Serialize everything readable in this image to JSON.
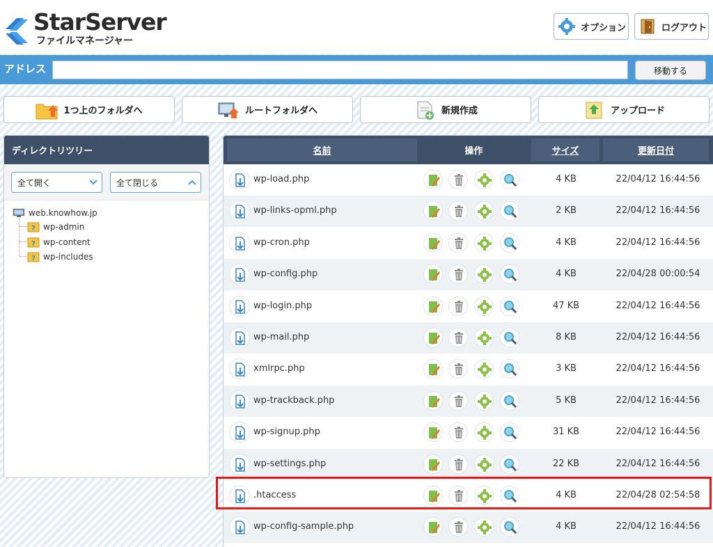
{
  "brand": {
    "title": "StarServer",
    "subtitle": "ファイルマネージャー",
    "accent": "#4a9ad8"
  },
  "header": {
    "option_label": "オプション",
    "logout_label": "ログアウト"
  },
  "address": {
    "label": "アドレス",
    "value": "",
    "go_label": "移動する"
  },
  "toolbar": {
    "up_label": "1つ上のフォルダへ",
    "root_label": "ルートフォルダへ",
    "new_label": "新規作成",
    "upload_label": "アップロード"
  },
  "tree": {
    "title": "ディレクトリツリー",
    "expand_label": "全て開く",
    "collapse_label": "全て閉じる",
    "root": "web.knowhow.jp",
    "children": [
      "wp-admin",
      "wp-content",
      "wp-includes"
    ]
  },
  "table": {
    "columns": {
      "name": "名前",
      "ops": "操作",
      "size": "サイズ",
      "date": "更新日付"
    },
    "rows": [
      {
        "name": "wp-load.php",
        "size": "4 KB",
        "date": "22/04/12 16:44:56"
      },
      {
        "name": "wp-links-opml.php",
        "size": "2 KB",
        "date": "22/04/12 16:44:56"
      },
      {
        "name": "wp-cron.php",
        "size": "4 KB",
        "date": "22/04/12 16:44:56"
      },
      {
        "name": "wp-config.php",
        "size": "4 KB",
        "date": "22/04/28 00:00:54"
      },
      {
        "name": "wp-login.php",
        "size": "47 KB",
        "date": "22/04/12 16:44:56"
      },
      {
        "name": "wp-mail.php",
        "size": "8 KB",
        "date": "22/04/12 16:44:56"
      },
      {
        "name": "xmlrpc.php",
        "size": "3 KB",
        "date": "22/04/12 16:44:56"
      },
      {
        "name": "wp-trackback.php",
        "size": "5 KB",
        "date": "22/04/12 16:44:56"
      },
      {
        "name": "wp-signup.php",
        "size": "31 KB",
        "date": "22/04/12 16:44:56"
      },
      {
        "name": "wp-settings.php",
        "size": "22 KB",
        "date": "22/04/12 16:44:56"
      },
      {
        "name": ".htaccess",
        "size": "4 KB",
        "date": "22/04/28 02:54:58"
      },
      {
        "name": "wp-config-sample.php",
        "size": "4 KB",
        "date": "22/04/12 16:44:56"
      }
    ],
    "highlight_color": "#e41919"
  }
}
